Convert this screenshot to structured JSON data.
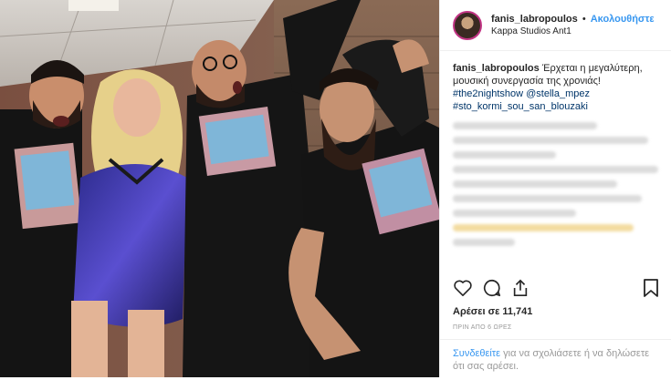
{
  "post": {
    "username": "fanis_labropoulos",
    "separator": "•",
    "follow_label": "Ακολουθήστε",
    "location": "Kappa Studios Ant1",
    "caption": {
      "username": "fanis_labropoulos",
      "text": "Έρχεται η μεγαλύτερη, μουσική συνεργασία της χρονιάς!",
      "hashtag1": "#the2nightshow",
      "mention": "@stella_mpez",
      "hashtag2": "#sto_kormi_sou_san_blouzaki"
    },
    "likes": "Αρέσει σε 11,741",
    "time": "ΠΡΙΝ ΑΠΟ 6 ΩΡΕΣ",
    "login": {
      "link": "Συνδεθείτε",
      "text": " για να σχολιάσετε ή να δηλώσετε ότι σας αρέσει."
    }
  },
  "icons": {
    "like": "heart-icon",
    "comment": "comment-icon",
    "share": "share-icon",
    "save": "bookmark-icon"
  },
  "colors": {
    "link": "#3897f0",
    "hashtag": "#003569",
    "text": "#262626",
    "muted": "#999999"
  }
}
